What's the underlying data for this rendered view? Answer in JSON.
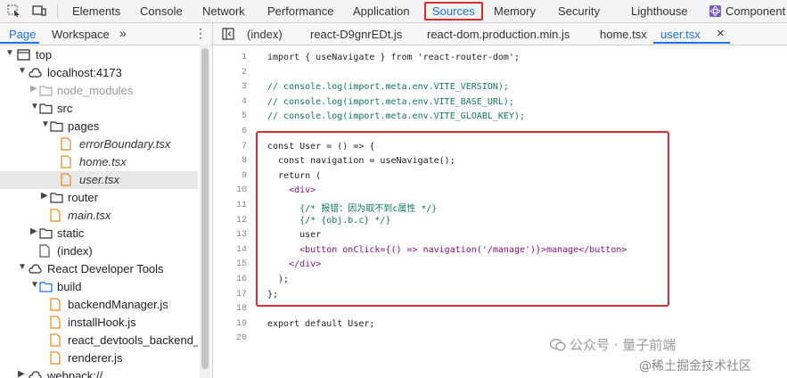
{
  "toolbar": {
    "tabs": [
      "Elements",
      "Console",
      "Network",
      "Performance",
      "Application",
      "Sources",
      "Memory",
      "Security",
      "Lighthouse",
      "Component"
    ],
    "active_tab": "Sources"
  },
  "sidebar": {
    "tabs": [
      "Page",
      "Workspace"
    ],
    "more": "»",
    "tree": [
      {
        "label": "top"
      },
      {
        "label": "localhost:4173"
      },
      {
        "label": "node_modules"
      },
      {
        "label": "src"
      },
      {
        "label": "pages"
      },
      {
        "label": "errorBoundary.tsx"
      },
      {
        "label": "home.tsx"
      },
      {
        "label": "user.tsx"
      },
      {
        "label": "router"
      },
      {
        "label": "main.tsx"
      },
      {
        "label": "static"
      },
      {
        "label": "(index)"
      },
      {
        "label": "React Developer Tools"
      },
      {
        "label": "build"
      },
      {
        "label": "backendManager.js"
      },
      {
        "label": "installHook.js"
      },
      {
        "label": "react_devtools_backend_c"
      },
      {
        "label": "renderer.js"
      },
      {
        "label": "webpack://"
      }
    ]
  },
  "editor": {
    "tabs": [
      "(index)",
      "react-D9gnrEDt.js",
      "react-dom.production.min.js",
      "home.tsx",
      "user.tsx"
    ],
    "active_tab": "user.tsx",
    "close": "×",
    "line_numbers": [
      "1",
      "2",
      "3",
      "4",
      "5",
      "6",
      "7",
      "8",
      "9",
      "10",
      "11",
      "12",
      "13",
      "14",
      "15",
      "16",
      "17",
      "18",
      "19",
      "20"
    ],
    "lines": [
      "import { useNavigate } from 'react-router-dom';",
      "",
      "// console.log(import.meta.env.VITE_VERSION);",
      "// console.log(import.meta.env.VITE_BASE_URL);",
      "// console.log(import.meta.env.VITE_GLOABL_KEY);",
      "",
      "const User = () => {",
      "  const navigation = useNavigate();",
      "  return (",
      "    <div>",
      "      {/* 报错：因为取不到c属性 */}",
      "      {/* {obj.b.c} */}",
      "      user",
      "      <button onClick={() => navigation('/manage')}>manage</button>",
      "    </div>",
      "  );",
      "};",
      "",
      "export default User;",
      ""
    ]
  },
  "watermark": {
    "line1": "公众号 · 量子前端",
    "line2": "@稀土掘金技术社区"
  }
}
